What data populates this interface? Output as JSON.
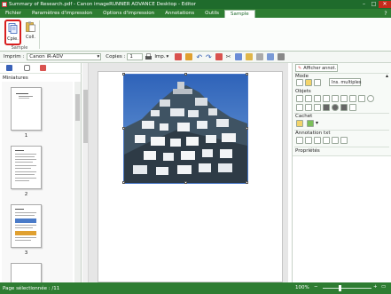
{
  "window": {
    "title": "Summary of Research.pdf - Canon imageRUNNER ADVANCE Desktop - Editor",
    "min": "–",
    "max": "□",
    "close": "✕"
  },
  "ribbon": {
    "tabs": [
      {
        "label": "Fichier",
        "active": false
      },
      {
        "label": "Paramètres d'impression",
        "active": false
      },
      {
        "label": "Options d'impression",
        "active": false
      },
      {
        "label": "Annotations",
        "active": false
      },
      {
        "label": "Outils",
        "active": false
      },
      {
        "label": "Sample",
        "active": true
      }
    ],
    "help": "?",
    "copy_label": "Cpie.",
    "coll_label": "Coll.",
    "group_label": "Sample"
  },
  "toolbar": {
    "printer_label": "Imprim :",
    "printer_value": "Canon iR-ADV",
    "copies_label": "Copies :",
    "copies_value": "1",
    "imp_label": "Imp."
  },
  "left_panel": {
    "title": "Miniatures",
    "pages": [
      "1",
      "2",
      "3"
    ]
  },
  "right_panel": {
    "annot_button": "Afficher annot.",
    "mode_label": "Mode",
    "img_mult": "Ins. multiples",
    "objets_label": "Objets",
    "cachet_label": "Cachet",
    "annotation_label": "Annotation txt",
    "proprietes_label": "Propriétés"
  },
  "status": {
    "page_label": "Page sélectionnée : /11",
    "zoom": "100%",
    "zoom_fraction": 0.35
  },
  "colors": {
    "titlebar": "#1f6b2c",
    "ribbon_tabs": "#2e7d32",
    "status": "#2e7d32",
    "highlight": "#d81e1e"
  }
}
